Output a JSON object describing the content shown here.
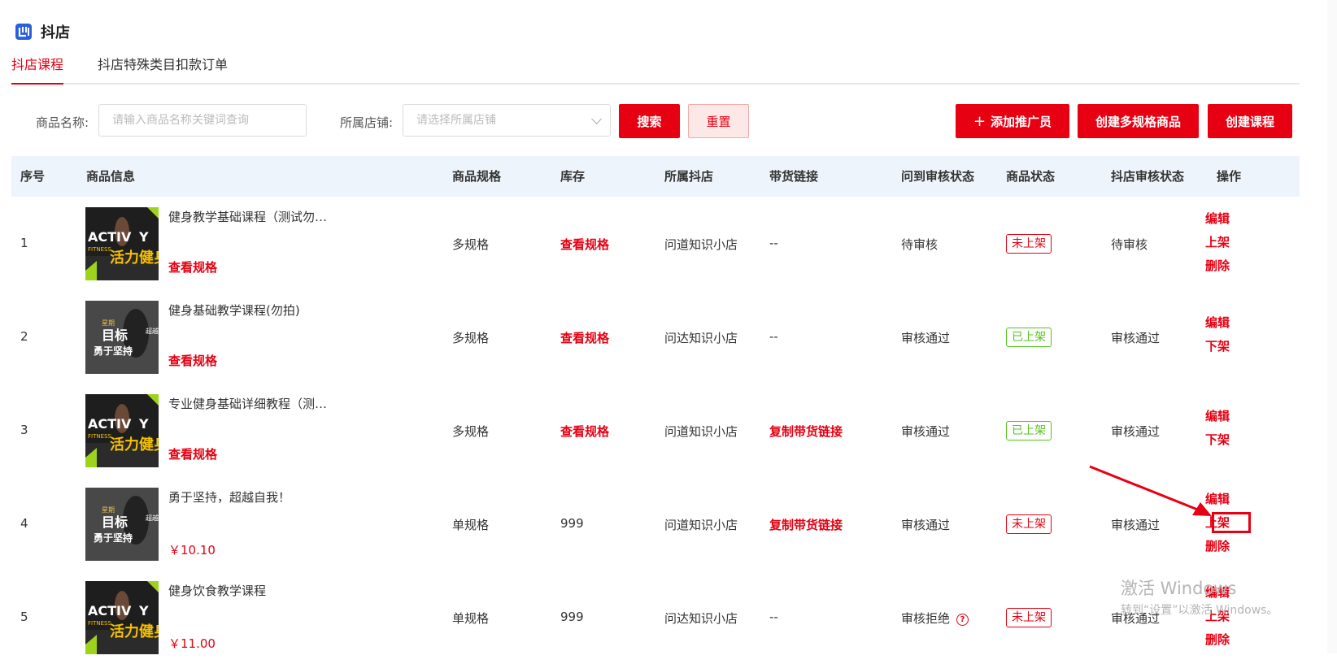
{
  "header": {
    "app_name": "抖店",
    "logo_icon": "douyin-store-logo"
  },
  "tabs": [
    {
      "label": "抖店课程",
      "active": true
    },
    {
      "label": "抖店特殊类目扣款订单",
      "active": false
    }
  ],
  "filters": {
    "name_label": "商品名称:",
    "name_placeholder": "请输入商品名称关键词查询",
    "store_label": "所属店铺:",
    "store_placeholder": "请选择所属店铺"
  },
  "buttons": {
    "search": "搜索",
    "reset": "重置",
    "add_promoter": "添加推广员",
    "create_multi": "创建多规格商品",
    "create_course": "创建课程"
  },
  "columns": [
    "序号",
    "商品信息",
    "商品规格",
    "库存",
    "所属抖店",
    "带货链接",
    "问到审核状态",
    "商品状态",
    "抖店审核状态",
    "操作"
  ],
  "rows": [
    {
      "index": "1",
      "title": "健身教学基础课程（测试勿…",
      "sub": "查看规格",
      "price": "",
      "spec": "多规格",
      "stock": "查看规格",
      "store": "问道知识小店",
      "link": "--",
      "review": "待审核",
      "status": "未上架",
      "status_type": "off",
      "dy_review": "待审核",
      "ops": [
        "编辑",
        "上架",
        "删除"
      ],
      "thumb": "activity"
    },
    {
      "index": "2",
      "title": "健身基础教学课程(勿拍)",
      "sub": "查看规格",
      "price": "",
      "spec": "多规格",
      "stock": "查看规格",
      "store": "问达知识小店",
      "link": "--",
      "review": "审核通过",
      "status": "已上架",
      "status_type": "on",
      "dy_review": "审核通过",
      "ops": [
        "编辑",
        "下架"
      ],
      "thumb": "goal"
    },
    {
      "index": "3",
      "title": "专业健身基础详细教程（测…",
      "sub": "查看规格",
      "price": "",
      "spec": "多规格",
      "stock": "查看规格",
      "store": "问道知识小店",
      "link": "复制带货链接",
      "review": "审核通过",
      "status": "已上架",
      "status_type": "on",
      "dy_review": "审核通过",
      "ops": [
        "编辑",
        "下架"
      ],
      "thumb": "activity"
    },
    {
      "index": "4",
      "title": "勇于坚持，超越自我！",
      "sub": "",
      "price": "￥10.10",
      "spec": "单规格",
      "stock": "999",
      "store": "问道知识小店",
      "link": "复制带货链接",
      "review": "审核通过",
      "status": "未上架",
      "status_type": "off",
      "dy_review": "审核通过",
      "ops": [
        "编辑",
        "上架",
        "删除"
      ],
      "thumb": "goal"
    },
    {
      "index": "5",
      "title": "健身饮食教学课程",
      "sub": "",
      "price": "￥11.00",
      "spec": "单规格",
      "stock": "999",
      "store": "问达知识小店",
      "link": "--",
      "review": "审核拒绝",
      "status": "未上架",
      "status_type": "off",
      "dy_review": "审核通过",
      "ops": [
        "编辑",
        "上架",
        "删除"
      ],
      "thumb": "activity"
    }
  ],
  "watermark": {
    "line1": "激活 Windows",
    "line2": "转到“设置”以激活 Windows。"
  },
  "colors": {
    "accent": "#e60012",
    "success": "#52c41a",
    "header_bg": "#eef4fb"
  }
}
